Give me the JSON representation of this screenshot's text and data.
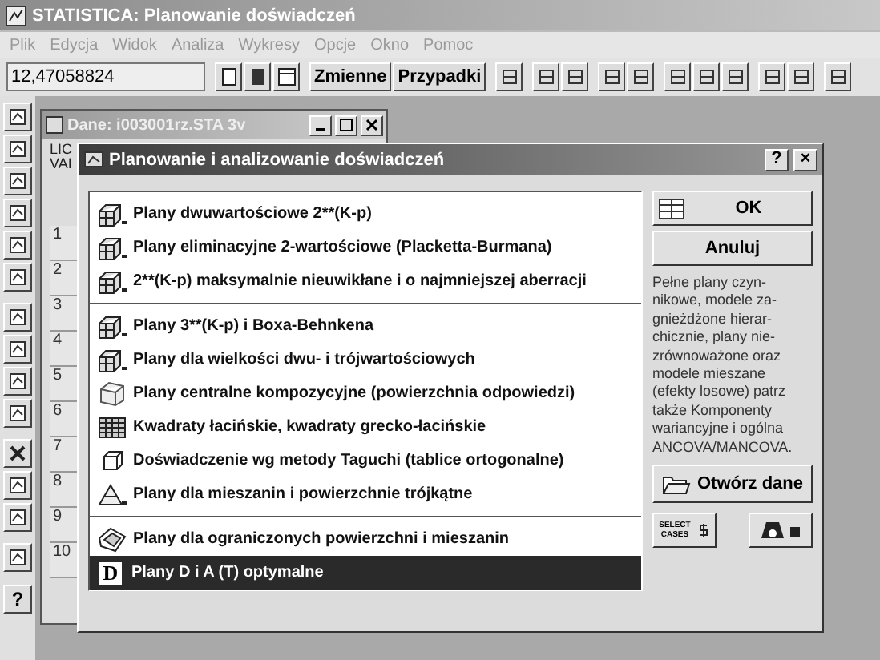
{
  "window": {
    "title": "STATISTICA: Planowanie doświadczeń"
  },
  "menu": [
    "Plik",
    "Edycja",
    "Widok",
    "Analiza",
    "Wykresy",
    "Opcje",
    "Okno",
    "Pomoc"
  ],
  "toolbar": {
    "value": "12,47058824",
    "buttons": [
      "Zmienne",
      "Przypadki"
    ]
  },
  "side_toolbar": {
    "help": "?"
  },
  "data_window": {
    "title": "Dane: i003001rz.STA 3v",
    "labels": [
      "LIC",
      "VAI"
    ],
    "rows": [
      "1",
      "2",
      "3",
      "4",
      "5",
      "6",
      "7",
      "8",
      "9",
      "10"
    ]
  },
  "dialog": {
    "title": "Planowanie i analizowanie doświadczeń",
    "help": "?",
    "close": "×",
    "groups": [
      [
        {
          "kind": "cube",
          "label": "Plany dwuwartościowe 2**(K-p)",
          "selected": false
        },
        {
          "kind": "cube",
          "label": "Plany eliminacyjne 2-wartościowe (Placketta-Burmana)",
          "selected": false
        },
        {
          "kind": "cube",
          "label": "2**(K-p) maksymalnie nieuwikłane i o najmniejszej aberracji",
          "selected": false
        }
      ],
      [
        {
          "kind": "cube",
          "label": "Plany 3**(K-p) i Boxa-Behnkena",
          "selected": false
        },
        {
          "kind": "cube",
          "label": "Plany dla wielkości dwu- i trójwartościowych",
          "selected": false
        },
        {
          "kind": "star",
          "label": "Plany centralne kompozycyjne (powierzchnia odpowiedzi)",
          "selected": false
        },
        {
          "kind": "grid",
          "label": "Kwadraty łacińskie, kwadraty grecko-łacińskie",
          "selected": false
        },
        {
          "kind": "box",
          "label": "Doświadczenie wg metody Taguchi (tablice ortogonalne)",
          "selected": false
        },
        {
          "kind": "triangle",
          "label": "Plany dla mieszanin i powierzchnie trójkątne",
          "selected": false
        }
      ],
      [
        {
          "kind": "polygon",
          "label": "Plany dla ograniczonych powierzchni i mieszanin",
          "selected": false
        },
        {
          "kind": "letter",
          "icon_text": "D",
          "label": "Plany D i A (T) optymalne",
          "selected": true
        }
      ]
    ],
    "ok": "OK",
    "cancel": "Anuluj",
    "description": [
      "Pełne plany czyn-",
      "nikowe, modele za-",
      "gnieżdżone hierar-",
      "chicznie, plany nie-",
      "zrównoważone oraz",
      "modele mieszane",
      "(efekty losowe) patrz",
      "także Komponenty",
      "wariancyjne i ogólna",
      "ANCOVA/MANCOVA."
    ],
    "open_button": "Otwórz dane",
    "select_cases": [
      "SELECT",
      "CASES"
    ]
  }
}
